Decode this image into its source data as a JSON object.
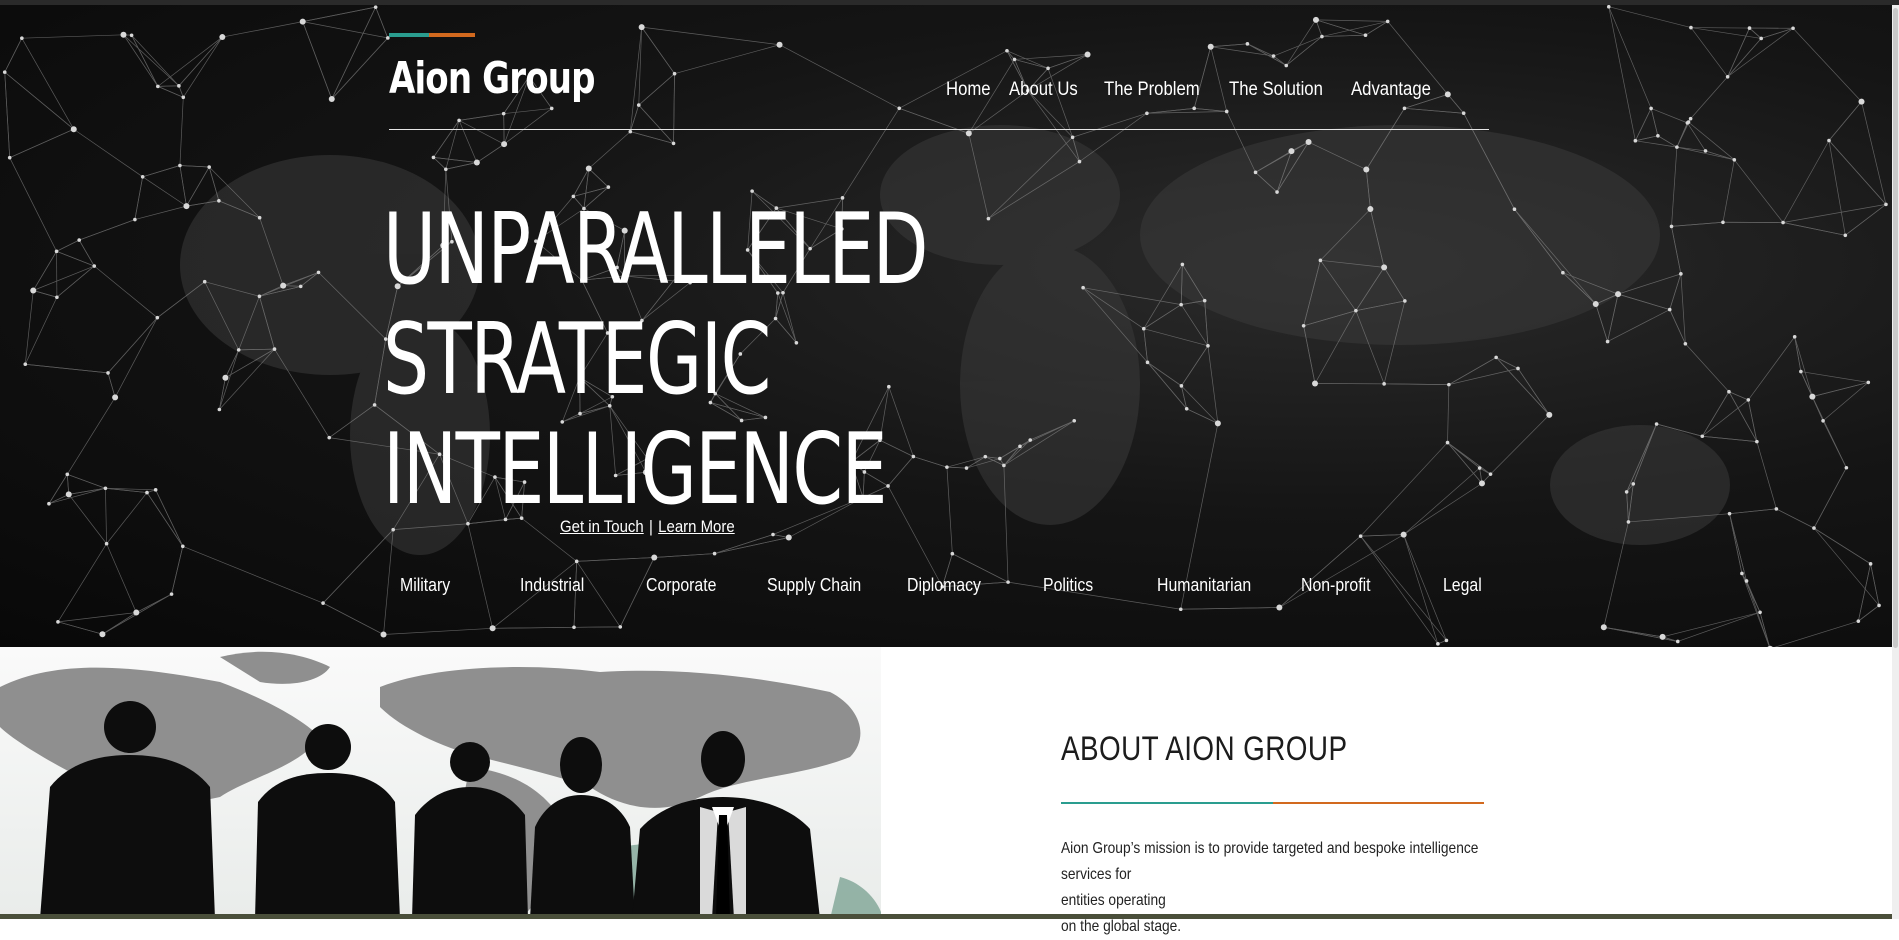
{
  "brand": {
    "name": "Aion Group",
    "accent_colors": [
      "#2a9d8f",
      "#d2691e"
    ]
  },
  "nav": {
    "items": [
      {
        "label": "Home"
      },
      {
        "label": "About Us"
      },
      {
        "label": "The Problem"
      },
      {
        "label": "The Solution"
      },
      {
        "label": "Advantage"
      }
    ]
  },
  "hero": {
    "headline_lines": [
      "UNPARALLELED",
      "STRATEGIC",
      "INTELLIGENCE"
    ],
    "cta_get_in_touch": "Get in Touch",
    "cta_separator": "|",
    "cta_learn_more": "Learn More",
    "sectors": [
      "Military",
      "Industrial",
      "Corporate",
      "Supply Chain",
      "Diplomacy",
      "Politics",
      "Humanitarian",
      "Non-profit",
      "Legal"
    ]
  },
  "about": {
    "title": "ABOUT AION GROUP",
    "text_line1": "Aion Group’s mission is to provide targeted and bespoke intelligence services for",
    "text_line2": "entities operating",
    "text_line3": "on the global stage."
  }
}
